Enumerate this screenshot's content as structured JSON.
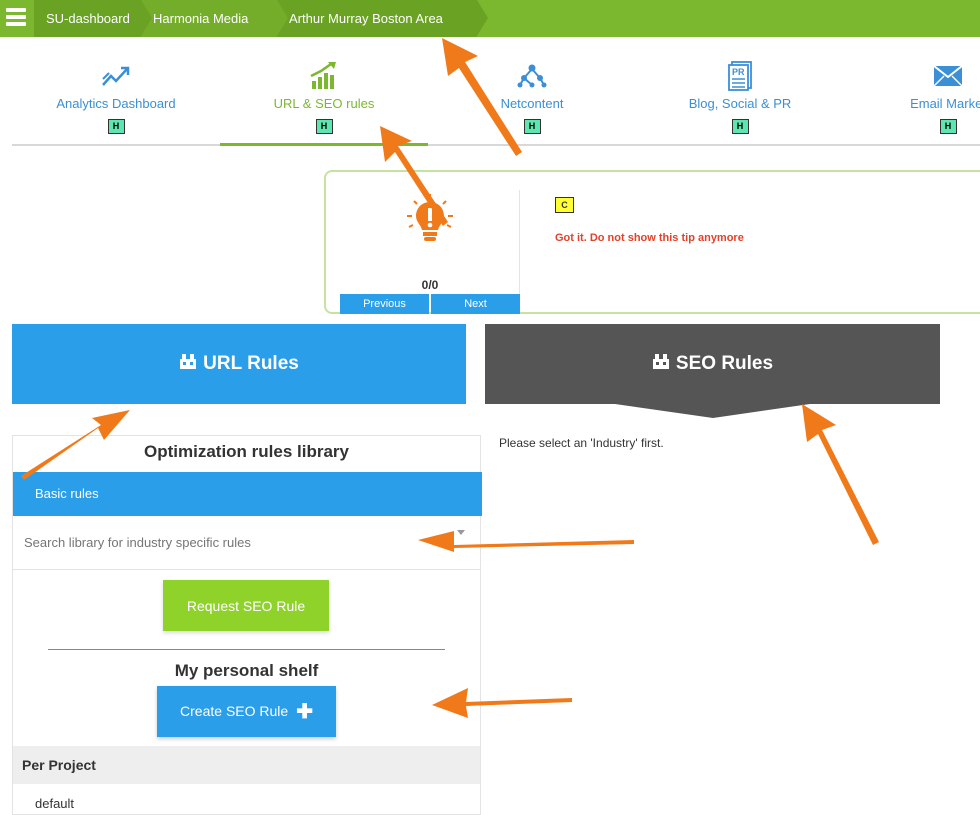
{
  "breadcrumbs": [
    "SU-dashboard",
    "Harmonia Media",
    "Arthur Murray Boston Area"
  ],
  "tabs": [
    {
      "label": "Analytics Dashboard",
      "icon": "analytics-chart-icon",
      "badge": "H"
    },
    {
      "label": "URL & SEO rules",
      "icon": "bar-chart-up-icon",
      "badge": "H",
      "active": true
    },
    {
      "label": "Netcontent",
      "icon": "network-icon",
      "badge": "H"
    },
    {
      "label": "Blog, Social & PR",
      "icon": "pr-document-icon",
      "badge": "H"
    },
    {
      "label": "Email Market",
      "icon": "envelope-icon",
      "badge": "H"
    }
  ],
  "tip": {
    "counter": "0/0",
    "previous_label": "Previous",
    "next_label": "Next",
    "badge": "C",
    "dismiss_link": "Got it. Do not show this tip anymore"
  },
  "panels": {
    "url_rules": "URL Rules",
    "seo_rules": "SEO Rules"
  },
  "library": {
    "title": "Optimization rules library",
    "basic_rules": "Basic rules",
    "search_placeholder": "Search library for industry specific rules",
    "request_button": "Request SEO Rule",
    "shelf_title": "My personal shelf",
    "create_button": "Create SEO Rule",
    "per_project": "Per Project",
    "default_item": "default"
  },
  "seo_message": "Please select an 'Industry' first.",
  "colors": {
    "topbar": "#7cb82f",
    "blue": "#2b9ee9",
    "dark_panel": "#555555",
    "green_button": "#8ed22a",
    "annotation_arrow": "#f07a1a"
  }
}
